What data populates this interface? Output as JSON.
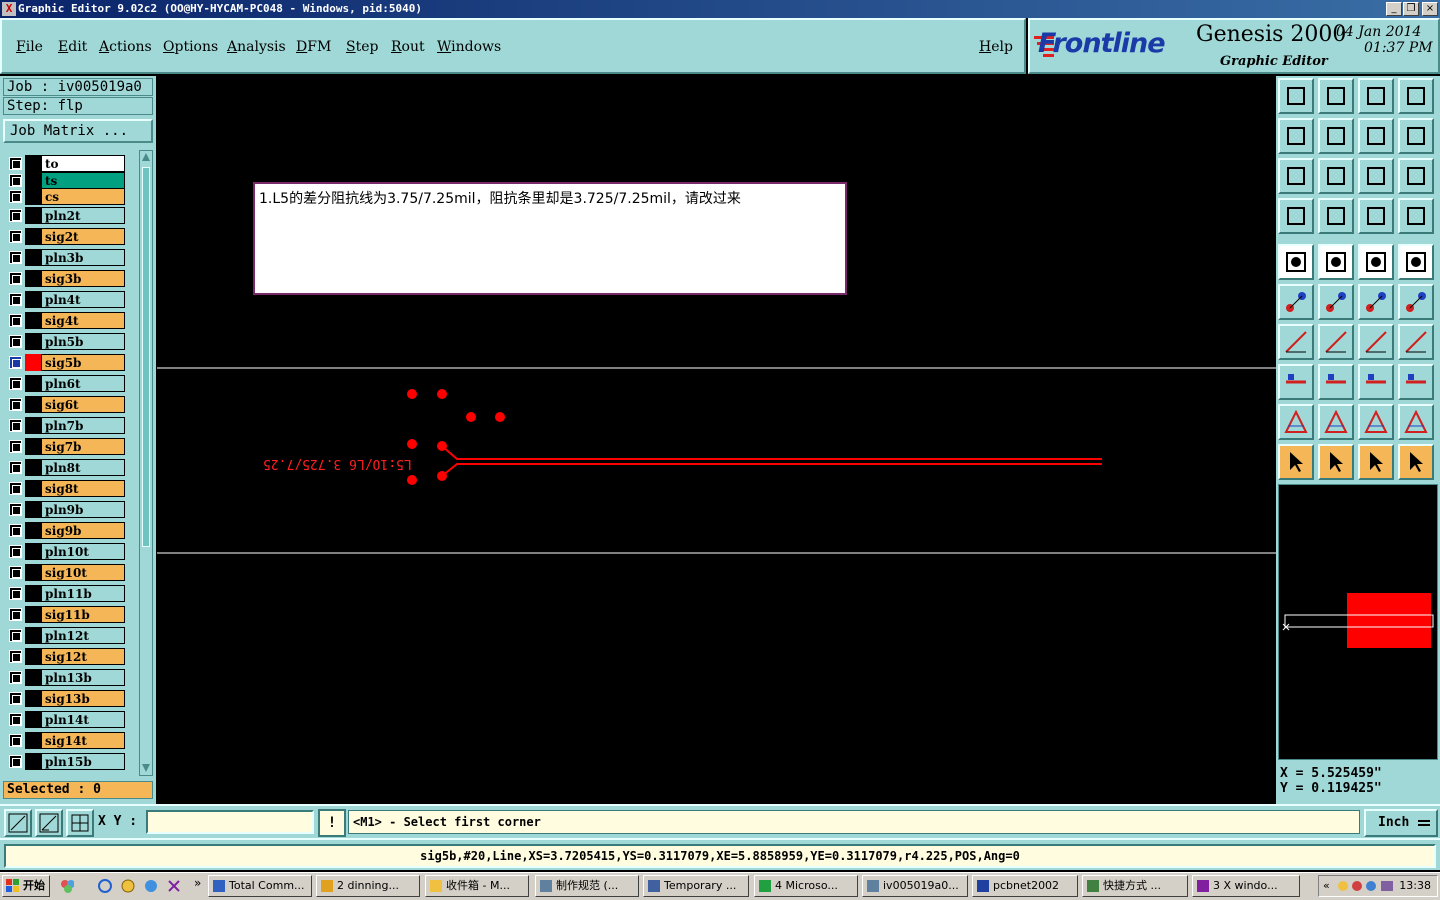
{
  "window": {
    "title": "Graphic Editor 9.02c2  (OO@HY-HYCAM-PC048 - Windows, pid:5040)",
    "icon_text": "X",
    "buttons": [
      "_",
      "❒",
      "×"
    ]
  },
  "menu": {
    "items": [
      "File",
      "Edit",
      "Actions",
      "Options",
      "Analysis",
      "DFM",
      "Step",
      "Rout",
      "Windows"
    ],
    "help": "Help"
  },
  "logo": {
    "brand": "Frontline",
    "product": "Genesis 2000",
    "subtitle": "Graphic Editor",
    "date": "04 Jan 2014",
    "time": "01:37 PM"
  },
  "left": {
    "job": "Job : iv005019a0",
    "step": "Step: flp",
    "job_matrix": "Job Matrix ...",
    "selected": "Selected : 0",
    "layers": [
      {
        "name": "to",
        "color": "#ffffff",
        "swatch": "#000000"
      },
      {
        "name": "ts",
        "color": "#00a080",
        "swatch": "#000000"
      },
      {
        "name": "cs",
        "color": "#f5b658",
        "swatch": "#000000"
      },
      {
        "name": "pln2t",
        "color": "#9fd8d6",
        "swatch": "#000000"
      },
      {
        "name": "sig2t",
        "color": "#f5b658",
        "swatch": "#000000"
      },
      {
        "name": "pln3b",
        "color": "#9fd8d6",
        "swatch": "#000000"
      },
      {
        "name": "sig3b",
        "color": "#f5b658",
        "swatch": "#000000"
      },
      {
        "name": "pln4t",
        "color": "#9fd8d6",
        "swatch": "#000000"
      },
      {
        "name": "sig4t",
        "color": "#f5b658",
        "swatch": "#000000"
      },
      {
        "name": "pln5b",
        "color": "#9fd8d6",
        "swatch": "#000000"
      },
      {
        "name": "sig5b",
        "color": "#f5b658",
        "swatch": "#ff0000",
        "active": true
      },
      {
        "name": "pln6t",
        "color": "#9fd8d6",
        "swatch": "#000000"
      },
      {
        "name": "sig6t",
        "color": "#f5b658",
        "swatch": "#000000"
      },
      {
        "name": "pln7b",
        "color": "#9fd8d6",
        "swatch": "#000000"
      },
      {
        "name": "sig7b",
        "color": "#f5b658",
        "swatch": "#000000"
      },
      {
        "name": "pln8t",
        "color": "#9fd8d6",
        "swatch": "#000000"
      },
      {
        "name": "sig8t",
        "color": "#f5b658",
        "swatch": "#000000"
      },
      {
        "name": "pln9b",
        "color": "#9fd8d6",
        "swatch": "#000000"
      },
      {
        "name": "sig9b",
        "color": "#f5b658",
        "swatch": "#000000"
      },
      {
        "name": "pln10t",
        "color": "#9fd8d6",
        "swatch": "#000000"
      },
      {
        "name": "sig10t",
        "color": "#f5b658",
        "swatch": "#000000"
      },
      {
        "name": "pln11b",
        "color": "#9fd8d6",
        "swatch": "#000000"
      },
      {
        "name": "sig11b",
        "color": "#f5b658",
        "swatch": "#000000"
      },
      {
        "name": "pln12t",
        "color": "#9fd8d6",
        "swatch": "#000000"
      },
      {
        "name": "sig12t",
        "color": "#f5b658",
        "swatch": "#000000"
      },
      {
        "name": "pln13b",
        "color": "#9fd8d6",
        "swatch": "#000000"
      },
      {
        "name": "sig13b",
        "color": "#f5b658",
        "swatch": "#000000"
      },
      {
        "name": "pln14t",
        "color": "#9fd8d6",
        "swatch": "#000000"
      },
      {
        "name": "sig14t",
        "color": "#f5b658",
        "swatch": "#000000"
      },
      {
        "name": "pln15b",
        "color": "#9fd8d6",
        "swatch": "#000000"
      }
    ]
  },
  "canvas": {
    "note": "1.L5的差分阻抗线为3.75/7.25mil，阻抗条里却是3.725/7.25mil，请改过来",
    "mirrored_label": "L5:1O/L6 3.725/7.25",
    "trace_color": "#ff0000",
    "guide_color": "#ffffff"
  },
  "coords": {
    "x": "X = 5.525459\"",
    "y": "Y = 0.119425\""
  },
  "command": {
    "xy_label": "X Y :",
    "xy_value": "",
    "alert": "!",
    "prompt": "<M1> - Select first corner",
    "units": "Inch"
  },
  "status": {
    "line": "sig5b,#20,Line,XS=3.7205415,YS=0.3117079,XE=5.8858959,YE=0.3117079,r4.225,POS,Ang=0"
  },
  "taskbar": {
    "start": "开始",
    "quick_more": "»",
    "tasks": [
      "Total Comm...",
      "2 dinning...",
      "收件箱 - M...",
      "制作规范 (...",
      "Temporary ...",
      "4 Microso...",
      "iv005019a0...",
      "pcbnet2002",
      "快捷方式 ...",
      "3 X windo..."
    ],
    "tray_arrow": "«",
    "clock": "13:38"
  }
}
